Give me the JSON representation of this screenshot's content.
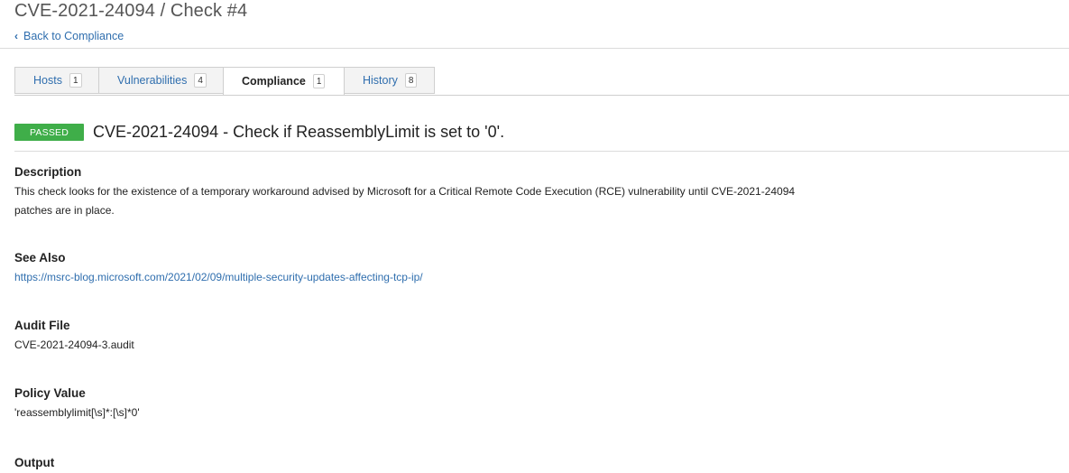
{
  "header": {
    "title": "CVE-2021-24094 / Check #4",
    "back_link": "Back to Compliance"
  },
  "tabs": [
    {
      "label": "Hosts",
      "count": "1",
      "active": false
    },
    {
      "label": "Vulnerabilities",
      "count": "4",
      "active": false
    },
    {
      "label": "Compliance",
      "count": "1",
      "active": true
    },
    {
      "label": "History",
      "count": "8",
      "active": false
    }
  ],
  "check": {
    "status": "PASSED",
    "status_color": "#3fae49",
    "title": "CVE-2021-24094 - Check if ReassemblyLimit is set to '0'."
  },
  "sections": {
    "description": {
      "heading": "Description",
      "text": "This check looks for the existence of a temporary workaround advised by Microsoft for a Critical Remote Code Execution (RCE) vulnerability until CVE-2021-24094 patches are in place."
    },
    "see_also": {
      "heading": "See Also",
      "link": "https://msrc-blog.microsoft.com/2021/02/09/multiple-security-updates-affecting-tcp-ip/"
    },
    "audit_file": {
      "heading": "Audit File",
      "value": "CVE-2021-24094-3.audit"
    },
    "policy_value": {
      "heading": "Policy Value",
      "value": "'reassemblylimit[\\s]*:[\\s]*0'"
    },
    "output": {
      "heading": "Output"
    }
  },
  "colors": {
    "link": "#2f6eae",
    "passed": "#3fae49"
  }
}
